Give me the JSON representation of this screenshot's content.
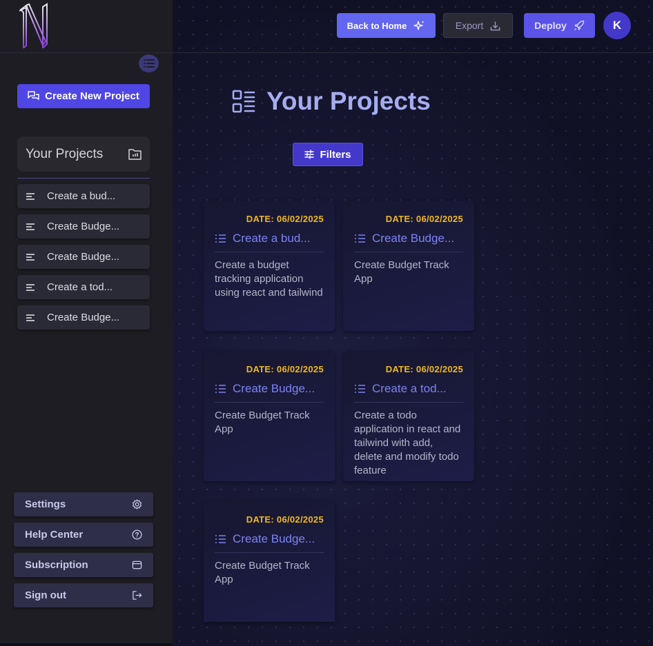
{
  "header": {
    "back_home": "Back to Home",
    "export": "Export",
    "deploy": "Deploy",
    "avatar_initial": "K"
  },
  "sidebar": {
    "create_button": "Create New Project",
    "panel_title": "Your Projects",
    "projects": [
      "Create a bud...",
      "Create Budge...",
      "Create Budge...",
      "Create a tod...",
      "Create Budge..."
    ],
    "bottom_menu": [
      {
        "label": "Settings",
        "icon": "gear-icon"
      },
      {
        "label": "Help Center",
        "icon": "help-icon"
      },
      {
        "label": "Subscription",
        "icon": "subscription-icon"
      },
      {
        "label": "Sign out",
        "icon": "sign-out-icon"
      }
    ]
  },
  "main": {
    "heading": "Your Projects",
    "filters": "Filters",
    "cards": [
      {
        "date": "DATE: 06/02/2025",
        "title": "Create a bud...",
        "desc": "Create a budget tracking application using react and tailwind"
      },
      {
        "date": "DATE: 06/02/2025",
        "title": "Create Budge...",
        "desc": "Create Budget Track App"
      },
      {
        "date": "DATE: 06/02/2025",
        "title": "Create Budge...",
        "desc": "Create Budget Track App"
      },
      {
        "date": "DATE: 06/02/2025",
        "title": "Create a tod...",
        "desc": "Create a todo application in react and tailwind with add, delete and modify todo feature"
      },
      {
        "date": "DATE: 06/02/2025",
        "title": "Create Budge...",
        "desc": "Create Budget Track App"
      }
    ]
  },
  "colors": {
    "accent": "#4f46e5",
    "date": "#f0b820",
    "card_title": "#7c83f4"
  }
}
